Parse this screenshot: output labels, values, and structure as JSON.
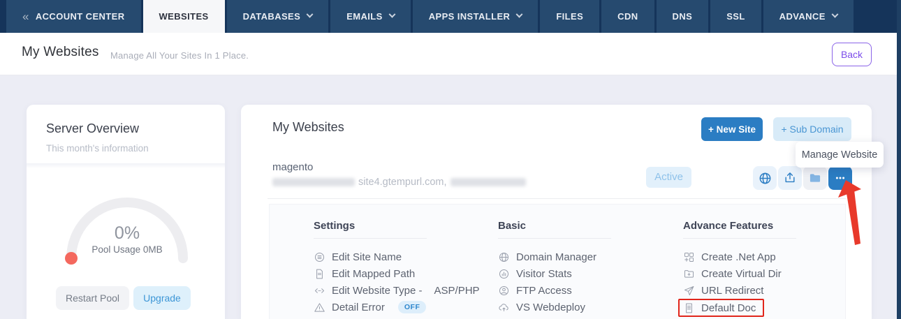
{
  "nav": {
    "back_icon": "«",
    "items": [
      {
        "label": "ACCOUNT CENTER",
        "chevron": false
      },
      {
        "label": "WEBSITES",
        "chevron": false,
        "active": true
      },
      {
        "label": "DATABASES",
        "chevron": true
      },
      {
        "label": "EMAILS",
        "chevron": true
      },
      {
        "label": "APPS INSTALLER",
        "chevron": true
      },
      {
        "label": "FILES",
        "chevron": false
      },
      {
        "label": "CDN",
        "chevron": false
      },
      {
        "label": "DNS",
        "chevron": false
      },
      {
        "label": "SSL",
        "chevron": false
      },
      {
        "label": "ADVANCE",
        "chevron": true
      }
    ]
  },
  "header": {
    "title": "My Websites",
    "subtitle": "Manage All Your Sites In 1 Place.",
    "back_label": "Back"
  },
  "server_overview": {
    "title": "Server Overview",
    "subtitle": "This month's information",
    "gauge": {
      "percent": "0%",
      "label": "Pool Usage 0MB"
    },
    "restart_label": "Restart Pool",
    "upgrade_label": "Upgrade"
  },
  "websites_panel": {
    "title": "My Websites",
    "new_site_label": "+ New Site",
    "sub_domain_label": "+ Sub Domain",
    "tooltip": "Manage Website",
    "site": {
      "name": "magento",
      "url_visible": "site4.gtempurl.com,",
      "status": "Active",
      "action_icons": [
        "globe-icon",
        "publish-icon",
        "folder-icon",
        "ellipsis-icon"
      ]
    }
  },
  "dropdown": {
    "columns": [
      {
        "header": "Settings",
        "items": [
          {
            "icon": "list-circle-icon",
            "label": "Edit Site Name"
          },
          {
            "icon": "document-icon",
            "label": "Edit Mapped Path"
          },
          {
            "icon": "code-icon",
            "label": "Edit Website Type -",
            "suffix": "ASP/PHP"
          },
          {
            "icon": "warning-icon",
            "label": "Detail Error",
            "badge": "OFF"
          }
        ]
      },
      {
        "header": "Basic",
        "items": [
          {
            "icon": "globe-icon",
            "label": "Domain Manager"
          },
          {
            "icon": "stats-icon",
            "label": "Visitor Stats"
          },
          {
            "icon": "user-icon",
            "label": "FTP Access"
          },
          {
            "icon": "cloud-upload-icon",
            "label": "VS Webdeploy"
          }
        ]
      },
      {
        "header": "Advance Features",
        "items": [
          {
            "icon": "grid-icon",
            "label": "Create .Net App"
          },
          {
            "icon": "folder-plus-icon",
            "label": "Create Virtual Dir"
          },
          {
            "icon": "send-icon",
            "label": "URL Redirect"
          },
          {
            "icon": "doc-icon",
            "label": "Default Doc",
            "highlighted": true
          }
        ]
      }
    ]
  },
  "colors": {
    "primary_blue": "#2b7dc3",
    "light_blue_bg": "#d8ebf8",
    "nav_bg": "#15345a",
    "nav_tab_bg": "#264a6f",
    "purple_accent": "#7c4dea",
    "annotation_red": "#e8392b",
    "gauge_dot_red": "#f4685e",
    "page_bg": "#ecedf5"
  }
}
